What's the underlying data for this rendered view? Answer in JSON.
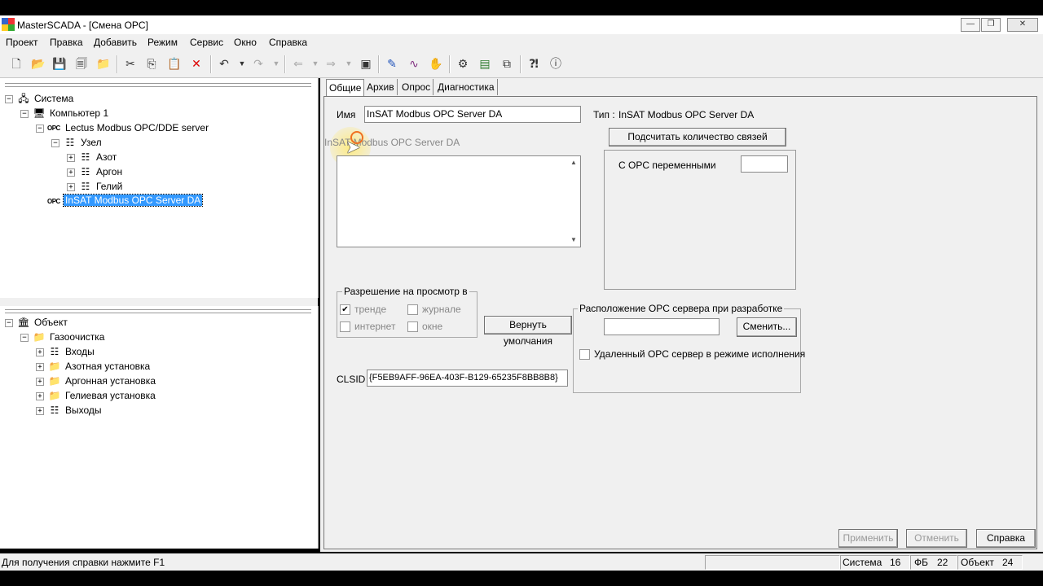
{
  "window": {
    "title": "MasterSCADA - [Смена OPC]",
    "controls": [
      "—",
      "❐",
      "✕"
    ]
  },
  "menu": [
    "Проект",
    "Правка",
    "Добавить",
    "Режим",
    "Сервис",
    "Окно",
    "Справка"
  ],
  "toolbar_icons": [
    "new-icon",
    "open-icon",
    "save-icon",
    "save-all-icon",
    "folder-icon",
    "cut-icon",
    "copy-icon",
    "paste-icon",
    "delete-icon",
    "undo-icon",
    "redo-icon",
    "back-icon",
    "forward-icon",
    "window-icon",
    "edit-icon",
    "wave-icon",
    "hand-icon",
    "network-icon",
    "chart-icon",
    "settings-icon",
    "help-context-icon",
    "help-icon"
  ],
  "tree_system": {
    "root": "Система",
    "computer": "Компьютер 1",
    "server1": "Lectus Modbus OPC/DDE server",
    "node": "Узел",
    "children": [
      "Азот",
      "Аргон",
      "Гелий"
    ],
    "server2": "InSAT Modbus OPC Server DA",
    "opc_tag": "OPC"
  },
  "tree_object": {
    "root": "Объект",
    "group": "Газоочистка",
    "children": [
      "Входы",
      "Азотная установка",
      "Аргонная установка",
      "Гелиевая установка",
      "Выходы"
    ]
  },
  "tabs": [
    "Общие",
    "Архив",
    "Опрос",
    "Диагностика"
  ],
  "general": {
    "name_label": "Имя",
    "name_value": "InSAT Modbus OPC Server DA",
    "drag_ghost": "InSAT Modbus OPC Server DA",
    "type_label": "Тип :",
    "type_value": "InSAT Modbus OPC Server DA",
    "count_button": "Подсчитать количество связей",
    "opc_vars_label": "С OPC переменными",
    "opc_vars_value": "",
    "view_group_title": "Разрешение на просмотр в",
    "view_trend": "тренде",
    "view_journal": "журнале",
    "view_internet": "интернет",
    "view_window": "окне",
    "defaults_button": "Вернуть умолчания",
    "location_group_title": "Расположение OPC сервера при разработке",
    "location_value": "",
    "change_button": "Сменить...",
    "remote_label": "Удаленный OPC сервер в режиме исполнения",
    "clsid_label": "CLSID :",
    "clsid_value": "{F5EB9AFF-96EA-403F-B129-65235F8BB8B8}"
  },
  "bottom_buttons": {
    "apply": "Применить",
    "cancel": "Отменить",
    "help": "Справка"
  },
  "status": {
    "hint": "Для получения справки нажмите F1",
    "system_label": "Система",
    "system_value": "16",
    "fb_label": "ФБ",
    "fb_value": "22",
    "object_label": "Объект",
    "object_value": "24"
  }
}
